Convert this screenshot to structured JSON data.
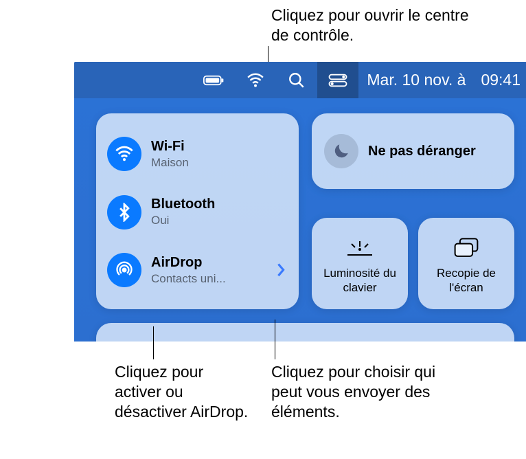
{
  "callouts": {
    "top": "Cliquez pour ouvrir le centre de contrôle.",
    "bottom_left": "Cliquez pour activer ou désactiver AirDrop.",
    "bottom_right": "Cliquez pour choisir qui peut vous envoyer des éléments."
  },
  "menubar": {
    "date": "Mar. 10 nov. à",
    "time": "09:41"
  },
  "control_center": {
    "wifi": {
      "title": "Wi-Fi",
      "subtitle": "Maison"
    },
    "bluetooth": {
      "title": "Bluetooth",
      "subtitle": "Oui"
    },
    "airdrop": {
      "title": "AirDrop",
      "subtitle": "Contacts uni..."
    },
    "dnd": "Ne pas déranger",
    "keyboard_brightness": "Luminosité du clavier",
    "screen_mirroring": "Recopie de l'écran"
  }
}
